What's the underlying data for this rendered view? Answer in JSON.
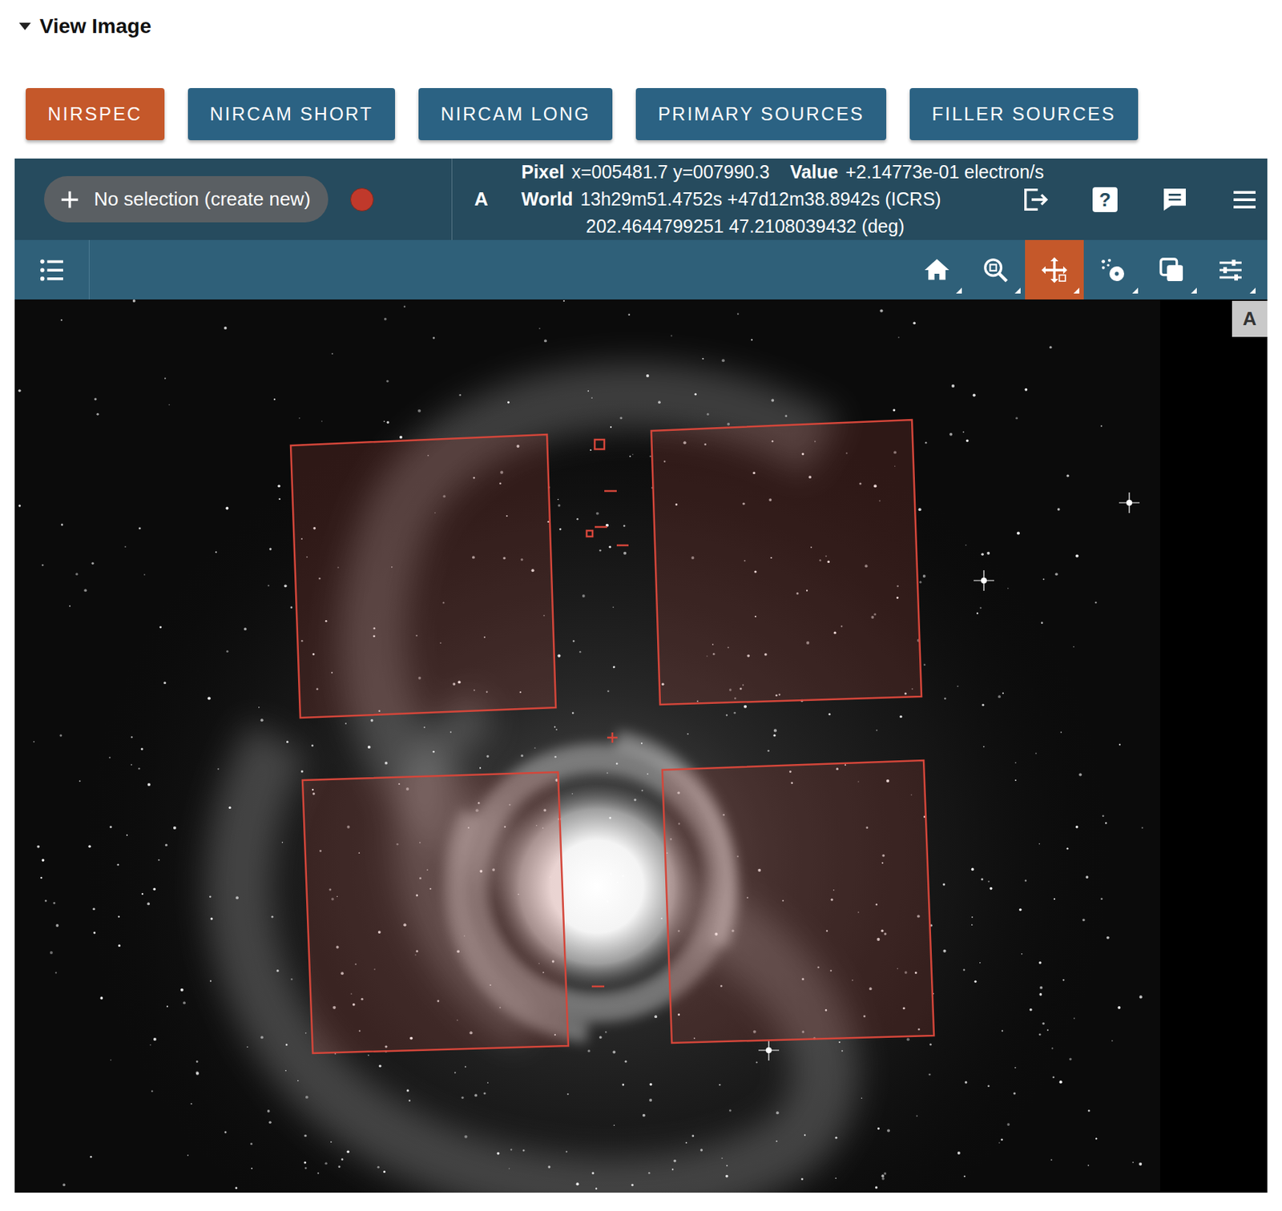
{
  "section": {
    "title": "View Image",
    "expanded": true
  },
  "tabs": [
    {
      "label": "NIRSPEC",
      "selected": true
    },
    {
      "label": "NIRCAM SHORT",
      "selected": false
    },
    {
      "label": "NIRCAM LONG",
      "selected": false
    },
    {
      "label": "PRIMARY SOURCES",
      "selected": false
    },
    {
      "label": "FILLER SOURCES",
      "selected": false
    }
  ],
  "viewer": {
    "selection": "No selection (create new)",
    "viewer_label": "A",
    "readout": {
      "pixel_label": "Pixel",
      "pixel": "x=005481.7 y=007990.3",
      "value_label": "Value",
      "value": "+2.14773e-01 electron/s",
      "world_label": "World",
      "world": "13h29m51.4752s +47d12m38.8942s (ICRS)",
      "world_deg": "202.4644799251 47.2108039432 (deg)"
    },
    "actions": [
      {
        "kind": "export"
      },
      {
        "kind": "help",
        "text": "?"
      },
      {
        "kind": "comment"
      },
      {
        "kind": "menu"
      }
    ],
    "tools": [
      {
        "kind": "home",
        "selected": false
      },
      {
        "kind": "zoom",
        "selected": false
      },
      {
        "kind": "pan",
        "selected": true
      },
      {
        "kind": "select",
        "selected": false
      },
      {
        "kind": "layers",
        "selected": false
      },
      {
        "kind": "settings",
        "selected": false
      }
    ],
    "image_label": "A"
  }
}
